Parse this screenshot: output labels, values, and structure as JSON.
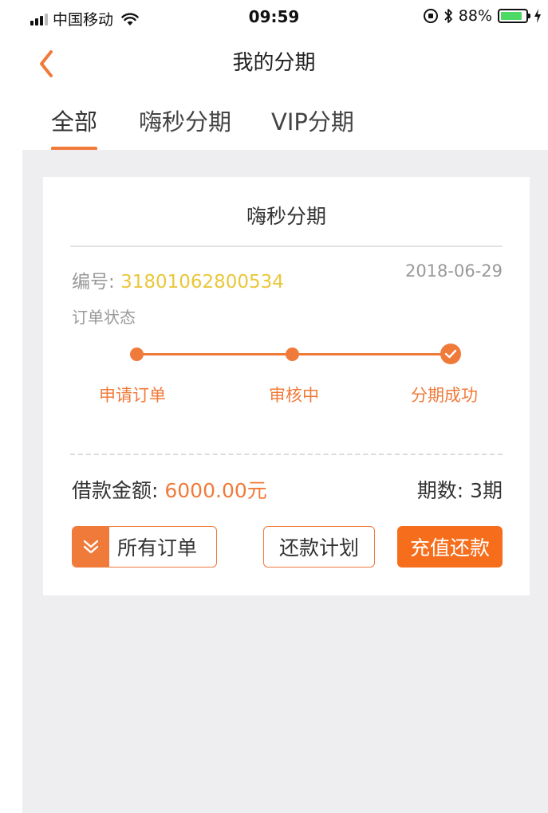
{
  "status_bar": {
    "carrier": "中国移动",
    "time": "09:59",
    "battery": "88%",
    "battery_level": 0.88
  },
  "nav": {
    "title": "我的分期"
  },
  "tabs": [
    {
      "label": "全部",
      "active": true
    },
    {
      "label": "嗨秒分期",
      "active": false
    },
    {
      "label": "VIP分期",
      "active": false
    }
  ],
  "card": {
    "title": "嗨秒分期",
    "order_no_label": "编号: ",
    "order_no": "31801062800534",
    "date": "2018-06-29",
    "status_label": "订单状态",
    "steps": [
      "申请订单",
      "审核中",
      "分期成功"
    ],
    "amount_label": "借款金额: ",
    "amount": "6000.00元",
    "periods": "期数:  3期",
    "buttons": {
      "all_orders": "所有订单",
      "repay_plan": "还款计划",
      "recharge_repay": "充值还款"
    }
  },
  "colors": {
    "accent": "#f07a3a",
    "order_no": "#e9c73a",
    "battery_fill": "#4cd964",
    "background": "#eeeef1"
  },
  "icons": [
    "signal-icon",
    "wifi-icon",
    "rotation-lock-icon",
    "bluetooth-icon",
    "battery-icon",
    "charging-icon",
    "back-chevron-icon",
    "check-icon",
    "double-chevron-down-icon"
  ]
}
